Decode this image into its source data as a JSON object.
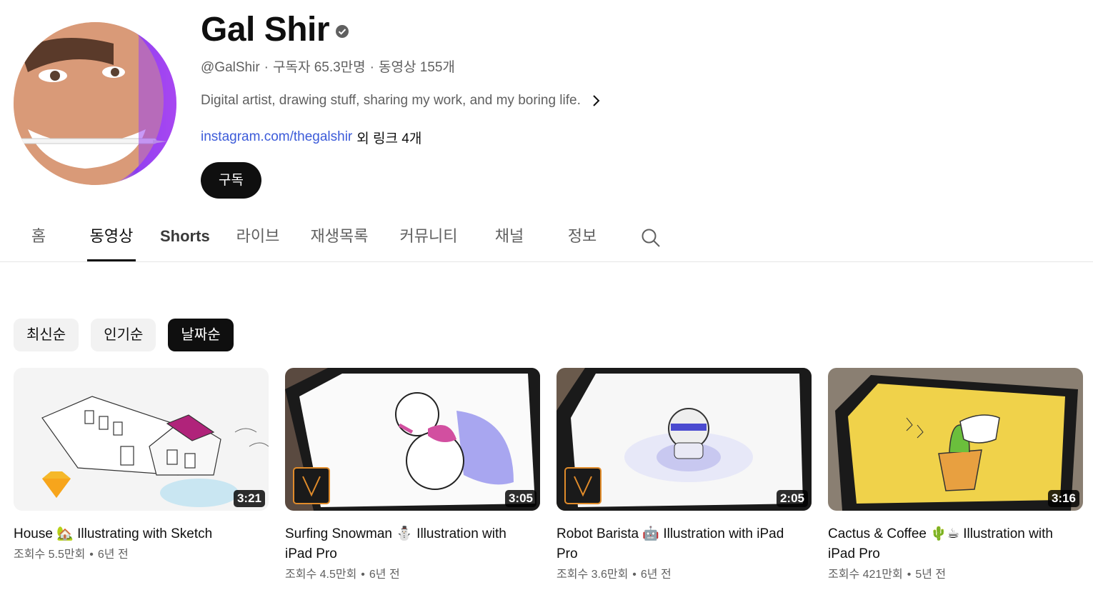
{
  "channel": {
    "name": "Gal Shir",
    "handle": "@GalShir",
    "subscribers": "구독자 65.3만명",
    "video_count": "동영상 155개",
    "description": "Digital artist, drawing stuff, sharing my work, and my boring life.",
    "link_text": "instagram.com/thegalshir",
    "more_links": "외 링크 4개",
    "subscribe_label": "구독",
    "meta_separator": "·"
  },
  "tabs": [
    {
      "label": "홈"
    },
    {
      "label": "동영상"
    },
    {
      "label": "Shorts"
    },
    {
      "label": "라이브"
    },
    {
      "label": "재생목록"
    },
    {
      "label": "커뮤니티"
    },
    {
      "label": "채널"
    },
    {
      "label": "정보"
    }
  ],
  "active_tab": "동영상",
  "sort_chips": [
    {
      "label": "최신순"
    },
    {
      "label": "인기순"
    },
    {
      "label": "날짜순"
    }
  ],
  "selected_chip": "날짜순",
  "videos": [
    {
      "title": "House 🏡 Illustrating with Sketch",
      "duration": "3:21",
      "views": "조회수 5.5만회",
      "age": "6년 전",
      "badge": "sketch-diamond-icon"
    },
    {
      "title": "Surfing Snowman ⛄ Illustration with iPad Pro",
      "duration": "3:05",
      "views": "조회수 4.5만회",
      "age": "6년 전",
      "badge": "vectornator-icon"
    },
    {
      "title": "Robot Barista 🤖 Illustration with iPad Pro",
      "duration": "2:05",
      "views": "조회수 3.6만회",
      "age": "6년 전",
      "badge": "vectornator-icon"
    },
    {
      "title": "Cactus & Coffee 🌵☕ Illustration with iPad Pro",
      "duration": "3:16",
      "views": "조회수 421만회",
      "age": "5년 전",
      "badge": ""
    }
  ],
  "views_age_separator": "•",
  "colors": {
    "link": "#3c5bd9",
    "subscribe_bg": "#0f0f0f",
    "chip_bg": "#f2f2f2",
    "secondary_text": "#606060"
  }
}
